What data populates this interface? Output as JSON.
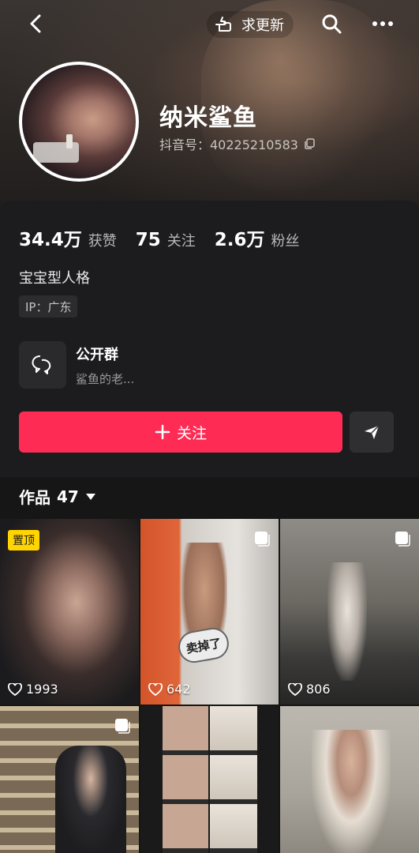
{
  "header": {
    "update_label": "求更新",
    "back_icon": "chevron-left-icon",
    "search_icon": "search-icon",
    "more_icon": "more-horizontal-icon"
  },
  "profile": {
    "nickname": "纳米鲨鱼",
    "douyin_id": "抖音号：40225210583"
  },
  "stats": [
    {
      "value": "34.4万",
      "label": "获赞"
    },
    {
      "value": "75",
      "label": "关注"
    },
    {
      "value": "2.6万",
      "label": "粉丝"
    }
  ],
  "bio": "宝宝型人格",
  "ip": "IP：广东",
  "group": {
    "title": "公开群",
    "subtitle": "鲨鱼的老..."
  },
  "actions": {
    "follow_label": "关注",
    "share_icon": "send-icon"
  },
  "works": {
    "label": "作品",
    "count": "47"
  },
  "grid": [
    {
      "likes": "1993",
      "badge": "置顶"
    },
    {
      "likes": "642",
      "sticker": "卖掉了"
    },
    {
      "likes": "806"
    },
    {
      "likes": ""
    },
    {
      "likes": ""
    },
    {
      "likes": ""
    }
  ],
  "colors": {
    "accent": "#fe2c55",
    "background": "#161616",
    "panel": "#1c1c1e",
    "pin_badge": "#ffd400"
  }
}
